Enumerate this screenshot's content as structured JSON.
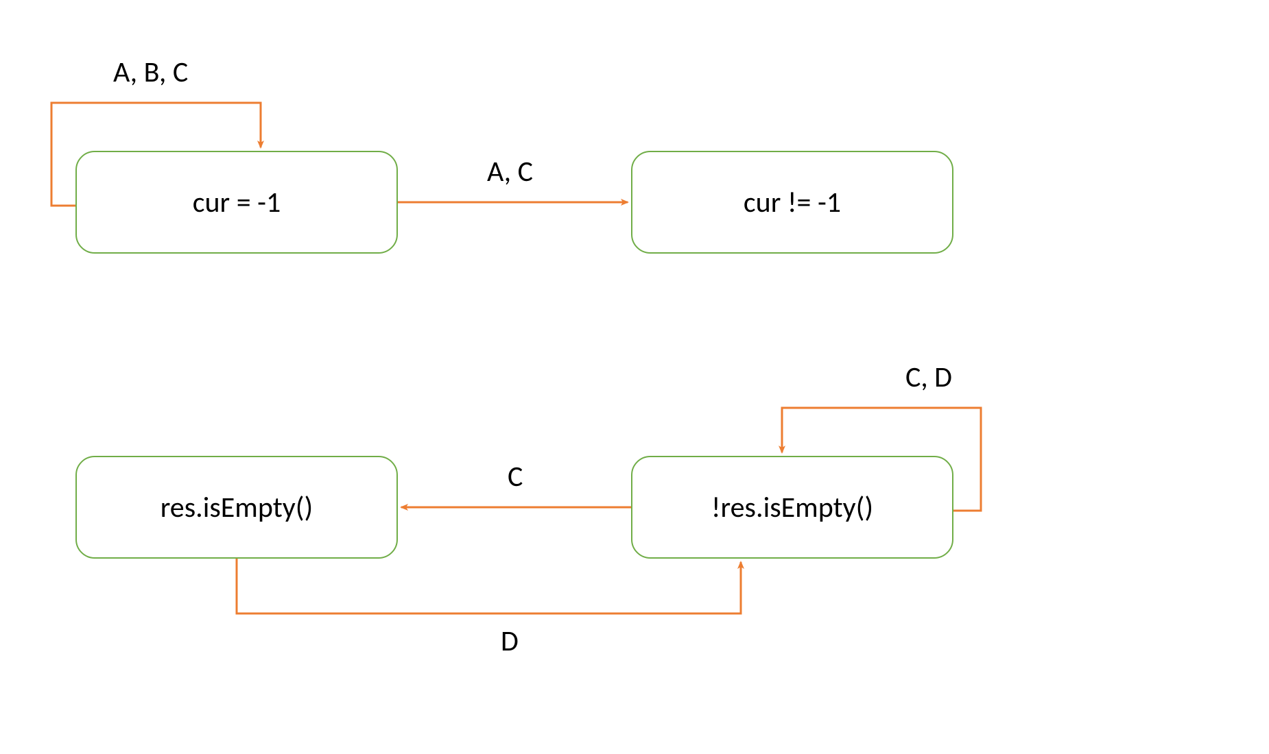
{
  "states": {
    "s1": "cur = -1",
    "s2": "cur != -1",
    "s3": "res.isEmpty()",
    "s4": "!res.isEmpty()"
  },
  "edges": {
    "e_self_s1": "A, B, C",
    "e_s1_s2": "A, C",
    "e_self_s4": "C, D",
    "e_s4_s3": "C",
    "e_s3_s4": "D"
  },
  "colors": {
    "node_border": "#70AD47",
    "arrow": "#ED7D31"
  }
}
